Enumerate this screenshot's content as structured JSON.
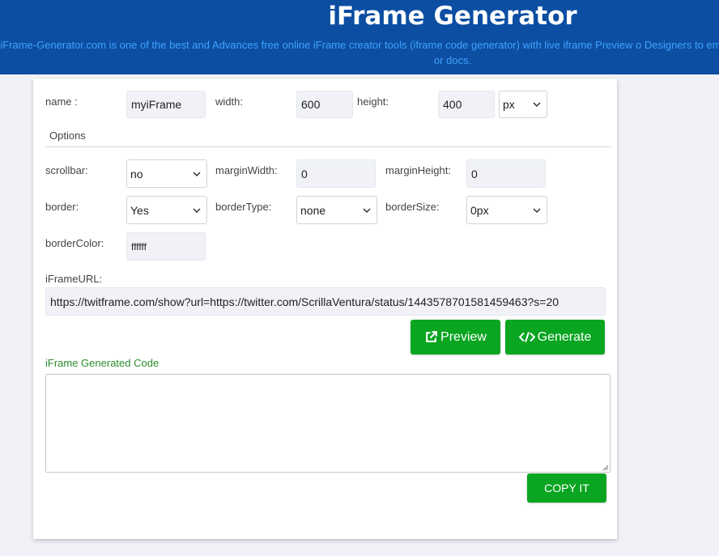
{
  "header": {
    "title": "iFrame Generator",
    "description": "iFrame-Generator.com is one of the best and Advances free online iFrame creator tools (iframe code generator) with live iframe Preview o Designers to embed any online page to any HTML page or docs."
  },
  "form": {
    "name_label": "name :",
    "name_value": "myiFrame",
    "width_label": "width:",
    "width_value": "600",
    "height_label": "height:",
    "height_value": "400",
    "unit_value": "px",
    "options_label": "Options",
    "scrollbar_label": "scrollbar:",
    "scrollbar_value": "no",
    "marginwidth_label": "marginWidth:",
    "marginwidth_value": "0",
    "marginheight_label": "marginHeight:",
    "marginheight_value": "0",
    "border_label": "border:",
    "border_value": "Yes",
    "bordertype_label": "borderType:",
    "bordertype_value": "none",
    "bordersize_label": "borderSize:",
    "bordersize_value": "0px",
    "bordercolor_label": "borderColor:",
    "bordercolor_value": "ffffff",
    "url_label": "iFrameURL:",
    "url_value": "https://twitframe.com/show?url=https://twitter.com/ScrillaVentura/status/1443578701581459463?s=20"
  },
  "buttons": {
    "preview": "Preview",
    "generate": "Generate",
    "copy": "COPY IT"
  },
  "output": {
    "label": "iFrame Generated Code",
    "code": ""
  },
  "colors": {
    "header_bg": "#0b4ea2",
    "button_green": "#0aa521",
    "generated_label": "#2c8c2c"
  }
}
